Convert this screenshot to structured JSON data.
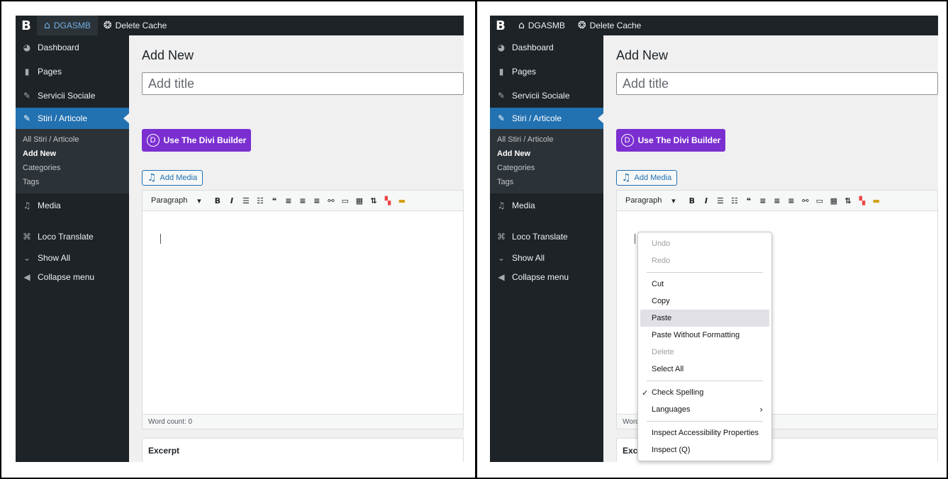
{
  "adminbar": {
    "logo": "B",
    "site_name": "DGASMB",
    "delete_cache": "Delete Cache"
  },
  "sidebar": {
    "dashboard": "Dashboard",
    "pages": "Pages",
    "servicii": "Servicii Sociale",
    "stiri": "Stiri / Articole",
    "sub": {
      "all": "All Stiri / Articole",
      "add_new": "Add New",
      "categories": "Categories",
      "tags": "Tags"
    },
    "media": "Media",
    "loco": "Loco Translate",
    "show_all": "Show All",
    "collapse": "Collapse menu"
  },
  "editor": {
    "page_title": "Add New",
    "title_placeholder": "Add title",
    "divi_letter": "D",
    "divi_button": "Use The Divi Builder",
    "add_media": "Add Media",
    "format": "Paragraph",
    "word_count": "Word count: 0",
    "word_count_truncated": "Word",
    "excerpt": "Excerpt",
    "excerpt_truncated": "Exce"
  },
  "context_menu": {
    "undo": "Undo",
    "redo": "Redo",
    "cut": "Cut",
    "copy": "Copy",
    "paste": "Paste",
    "paste_plain": "Paste Without Formatting",
    "delete": "Delete",
    "select_all": "Select All",
    "check_spelling": "Check Spelling",
    "languages": "Languages",
    "inspect_a11y": "Inspect Accessibility Properties",
    "inspect": "Inspect (Q)"
  }
}
